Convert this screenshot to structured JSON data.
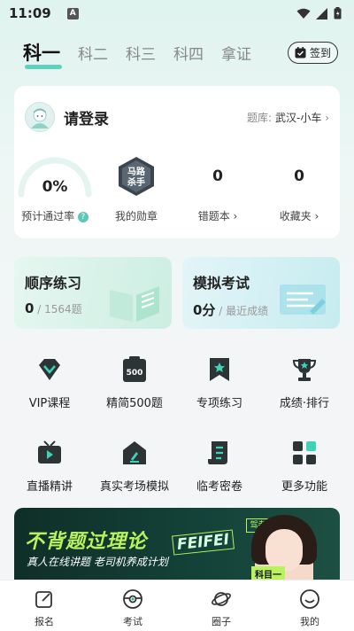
{
  "status": {
    "time": "11:09",
    "a_icon": "A"
  },
  "tabs": [
    {
      "label": "科一",
      "active": true
    },
    {
      "label": "科二",
      "active": false
    },
    {
      "label": "科三",
      "active": false
    },
    {
      "label": "科四",
      "active": false
    },
    {
      "label": "拿证",
      "active": false
    }
  ],
  "checkin": {
    "label": "签到",
    "icon": "calendar-check-icon"
  },
  "user": {
    "login_text": "请登录",
    "bank_label": "题库:",
    "bank_value": "武汉-小车",
    "bank_arrow": "›"
  },
  "stats": {
    "pass_rate": {
      "value": "0%",
      "label": "预计通过率",
      "help": "?"
    },
    "medal": {
      "label": "我的勋章",
      "badge_line1": "马路",
      "badge_line2": "杀手"
    },
    "wrong": {
      "value": "0",
      "label": "错题本 ›"
    },
    "fav": {
      "value": "0",
      "label": "收藏夹 ›"
    }
  },
  "practice": {
    "seq": {
      "title": "顺序练习",
      "done": "0",
      "total": " / 1564题"
    },
    "mock": {
      "title": "模拟考试",
      "score": "0分",
      "note": " / 最近成绩"
    }
  },
  "grid": [
    {
      "label": "VIP课程",
      "icon": "vip-diamond-icon"
    },
    {
      "label": "精简500题",
      "icon": "500-questions-icon",
      "icon_text": "500"
    },
    {
      "label": "专项练习",
      "icon": "bookmark-star-icon"
    },
    {
      "label": "成绩·排行",
      "icon": "trophy-icon"
    },
    {
      "label": "直播精讲",
      "icon": "tv-play-icon"
    },
    {
      "label": "真实考场模拟",
      "icon": "exam-room-icon"
    },
    {
      "label": "临考密卷",
      "icon": "scroll-paper-icon"
    },
    {
      "label": "更多功能",
      "icon": "apps-grid-icon"
    }
  ],
  "banner": {
    "title": "不背题过理论",
    "subtitle": "真人在线讲题 老司机养成计划",
    "tag": "驾考版",
    "name": "FEIFEI",
    "kemu": "科目一"
  },
  "nav": [
    {
      "label": "报名",
      "icon": "signup-edit-icon"
    },
    {
      "label": "考试",
      "icon": "steering-wheel-icon"
    },
    {
      "label": "圈子",
      "icon": "planet-icon"
    },
    {
      "label": "我的",
      "icon": "smile-profile-icon"
    }
  ],
  "colors": {
    "accent": "#2ac2a6",
    "banner_green": "#b9f25c",
    "icon_dark": "#2d3436"
  }
}
